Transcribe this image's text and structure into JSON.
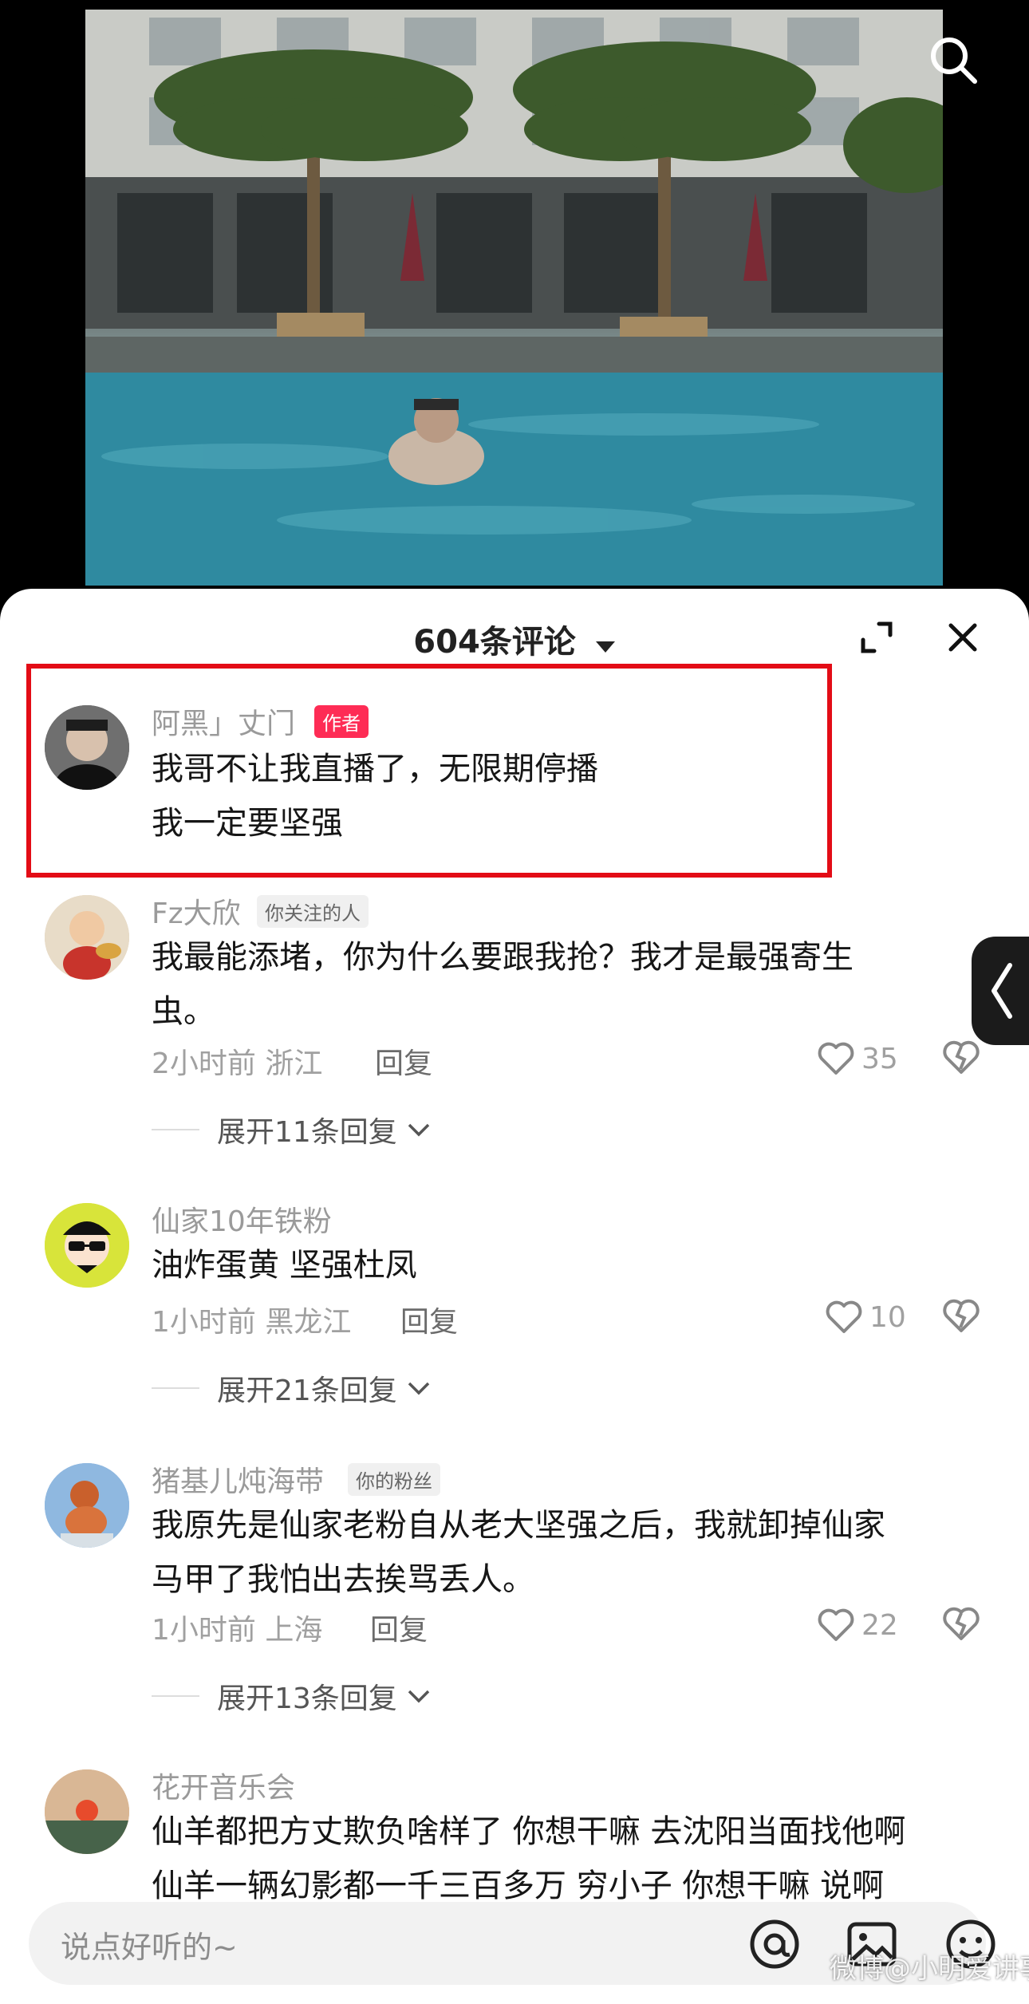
{
  "sheet": {
    "title": "604条评论"
  },
  "comments": [
    {
      "username": "阿黑」丈门",
      "tag": "作者",
      "content_lines": [
        "我哥不让我直播了，无限期停播",
        "我一定要坚强"
      ]
    },
    {
      "username": "Fz大欣",
      "tag": "你关注的人",
      "content_lines": [
        "我最能添堵，你为什么要跟我抢？我才是最强寄生",
        "虫。"
      ],
      "meta": "2小时前 浙江",
      "reply": "回复",
      "likes": "35",
      "expand": "展开11条回复"
    },
    {
      "username": "仙家10年铁粉",
      "content_lines": [
        "油炸蛋黄 坚强杜凤"
      ],
      "meta": "1小时前 黑龙江",
      "reply": "回复",
      "likes": "10",
      "expand": "展开21条回复"
    },
    {
      "username": "猪基儿炖海带",
      "tag": "你的粉丝",
      "content_lines": [
        "我原先是仙家老粉自从老大坚强之后，我就卸掉仙家",
        "马甲了我怕出去挨骂丢人。"
      ],
      "meta": "1小时前 上海",
      "reply": "回复",
      "likes": "22",
      "expand": "展开13条回复"
    },
    {
      "username": "花开音乐会",
      "content_lines": [
        "仙羊都把方丈欺负啥样了 你想干嘛 去沈阳当面找他啊",
        "仙羊一辆幻影都一千三百多万 穷小子 你想干嘛 说啊"
      ]
    }
  ],
  "input": {
    "placeholder": "说点好听的~"
  },
  "watermark": "微博@小明爱讲事",
  "icons": {
    "search": "search-icon",
    "expand": "fullscreen-icon",
    "close": "close-icon",
    "like": "heart-icon",
    "dislike": "broken-heart-icon",
    "at": "at-icon",
    "image": "image-icon",
    "emoji": "emoji-icon"
  },
  "colors": {
    "author_tag": "#fe2c55",
    "highlight_box": "#e30c16",
    "pool_water": "#2c7f96"
  }
}
